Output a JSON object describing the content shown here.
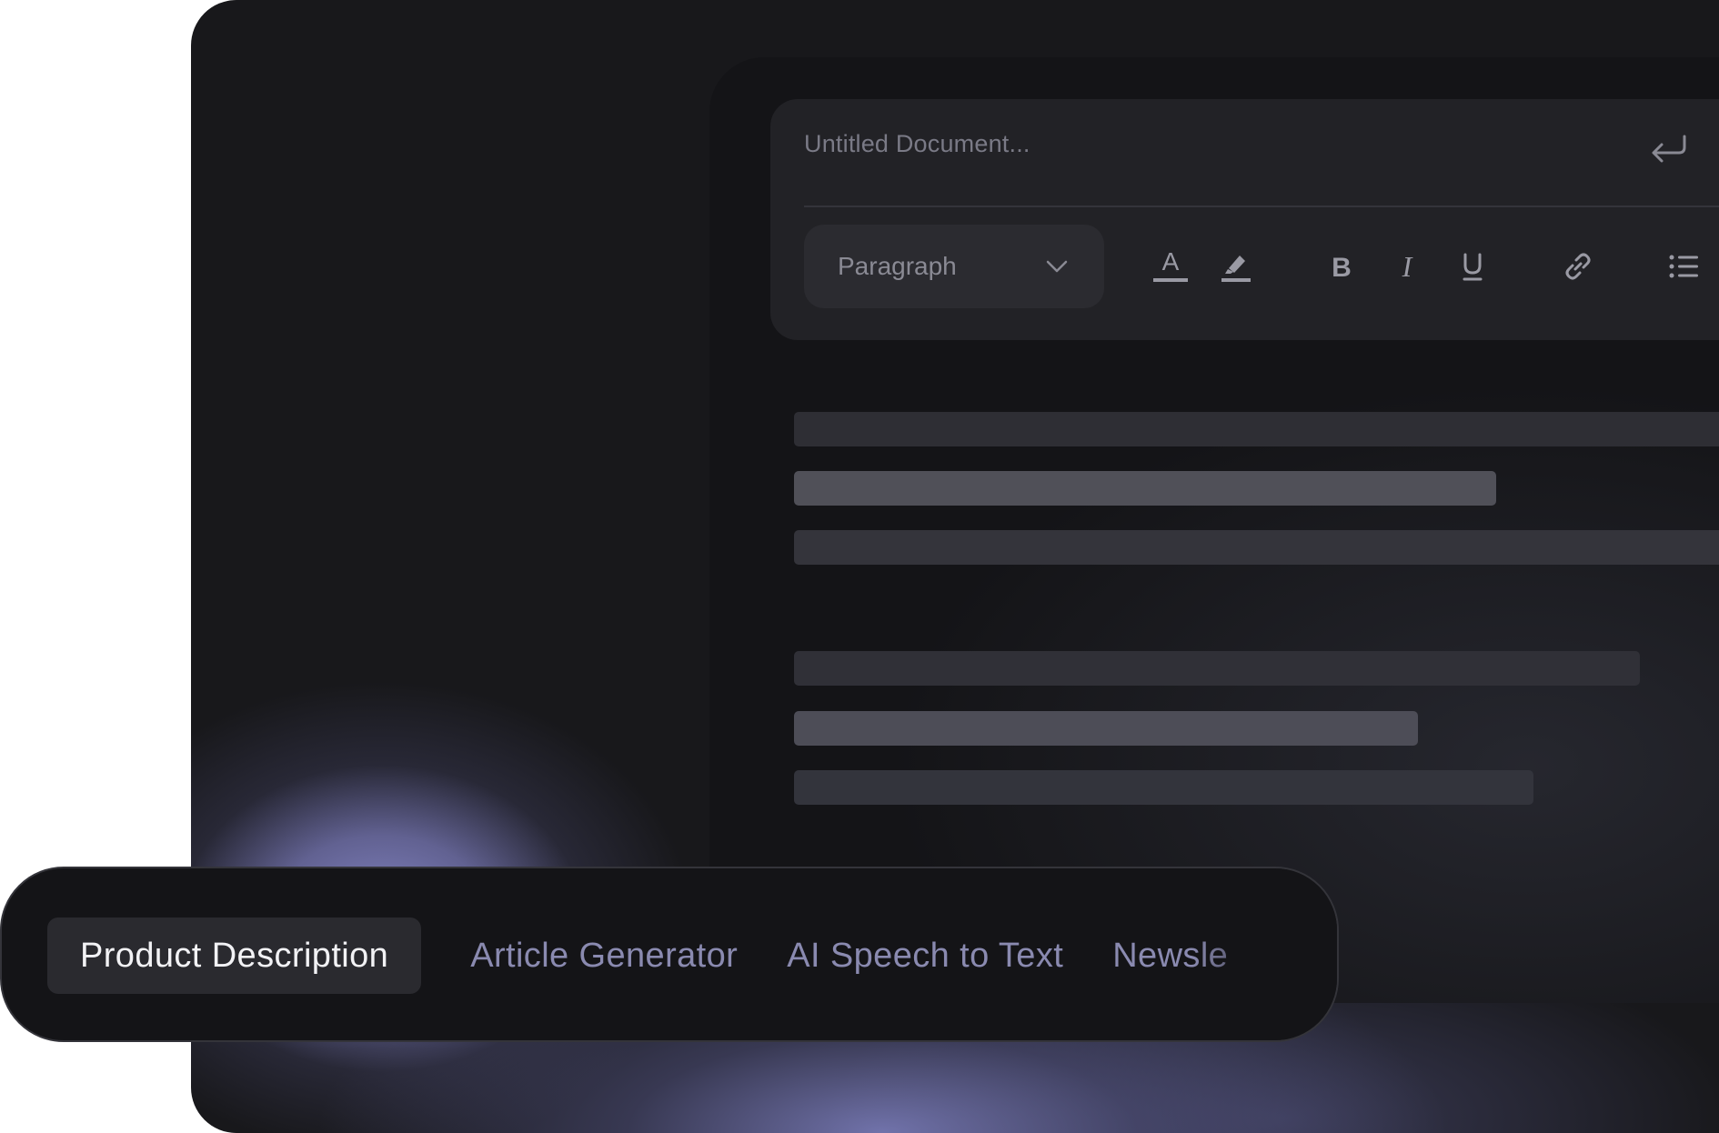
{
  "document": {
    "title": "Untitled Document..."
  },
  "toolbar": {
    "top_icons": [
      "undo-icon",
      "redo-icon",
      "copy-icon",
      "download-icon"
    ],
    "block_format": {
      "selected": "Paragraph"
    },
    "format_icons": [
      "text-color-icon",
      "highlight-icon",
      "bold-icon",
      "italic-icon",
      "underline-icon",
      "link-icon",
      "bullet-list-icon",
      "numbered-list-icon",
      "align-left-icon"
    ]
  },
  "tabs": {
    "items": [
      {
        "label": "Product Description",
        "active": true
      },
      {
        "label": "Article Generator",
        "active": false
      },
      {
        "label": "AI Speech to Text",
        "active": false
      },
      {
        "label": "Newsle",
        "active": false
      }
    ]
  },
  "colors": {
    "background": "#18181b",
    "panel": "#141417",
    "toolbar": "#222226",
    "accent_glow": "#898acc",
    "active_tab": "#2a2a2f",
    "tab_text": "#8a8ab0"
  }
}
